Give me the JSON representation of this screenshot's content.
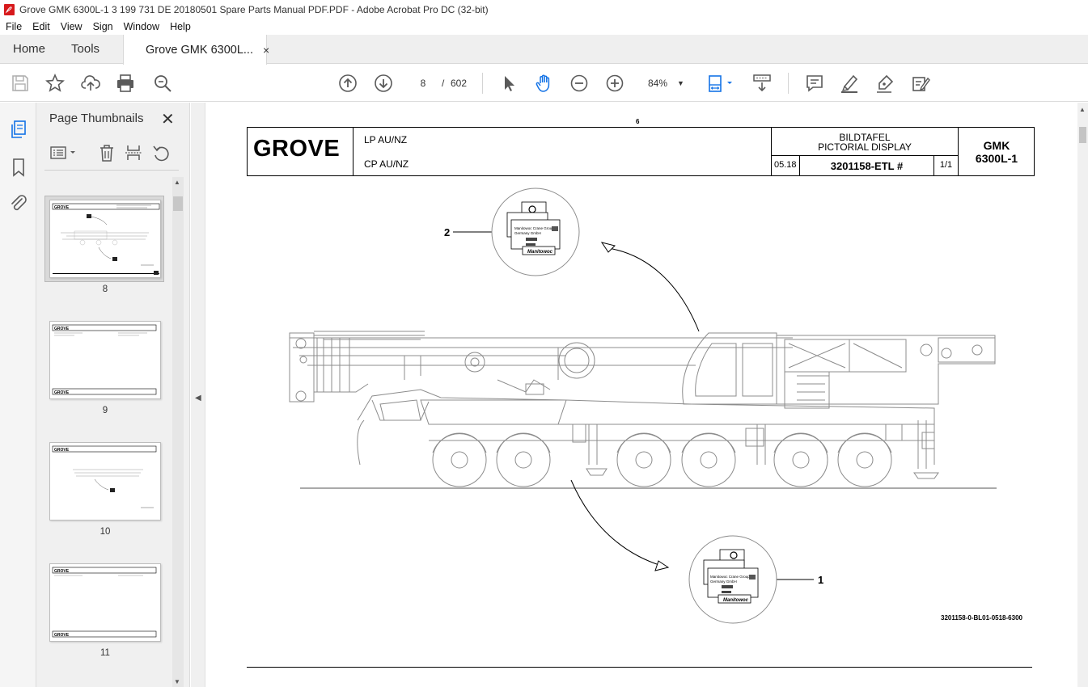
{
  "window": {
    "title": "Grove GMK 6300L-1 3 199 731 DE 20180501 Spare Parts Manual PDF.PDF - Adobe Acrobat Pro DC (32-bit)"
  },
  "menu": [
    "File",
    "Edit",
    "View",
    "Sign",
    "Window",
    "Help"
  ],
  "tabs": {
    "home": "Home",
    "tools": "Tools",
    "document": "Grove GMK 6300L...",
    "close": "×"
  },
  "toolbar": {
    "current_page": "8",
    "page_separator": "/",
    "total_pages": "602",
    "zoom": "84%",
    "icons": [
      "save-icon",
      "bookmark-star-icon",
      "upload-icon",
      "print-icon",
      "zoom-search-icon",
      "page-up-icon",
      "page-down-icon",
      "select-cursor-icon",
      "hand-tool-icon",
      "zoom-out-icon",
      "zoom-in-icon",
      "fit-page-icon",
      "scroll-mode-icon",
      "comment-icon",
      "highlight-pen-icon",
      "sign-icon",
      "edit-pdf-icon"
    ]
  },
  "thumbnail_panel": {
    "title": "Page Thumbnails",
    "close": "✕",
    "thumbnails": [
      {
        "label": "8",
        "selected": true
      },
      {
        "label": "9",
        "selected": false
      },
      {
        "label": "10",
        "selected": false
      },
      {
        "label": "11",
        "selected": false
      }
    ]
  },
  "page": {
    "top_number": "6",
    "logo": "GROVE",
    "variant_1": "LP AU/NZ",
    "variant_2": "CP AU/NZ",
    "title_de": "BILDTAFEL",
    "title_en": "PICTORIAL DISPLAY",
    "date": "05.18",
    "part_number": "3201158-ETL #",
    "sheet": "1/1",
    "model_line1": "GMK",
    "model_line2": "6300L-1",
    "callout_1": "1",
    "callout_2": "2",
    "plate_company": "Manitowoc Crane Group",
    "plate_subtitle": "Germany GmbH",
    "plate_brand": "Manitowoc",
    "drawing_code": "3201158-0-BL01-0518-6300"
  },
  "colors": {
    "tab_bar": "#efefef",
    "panel_bg": "#f0f0f0",
    "icon_gray": "#5a5a5a",
    "icon_blue": "#1473e6"
  }
}
